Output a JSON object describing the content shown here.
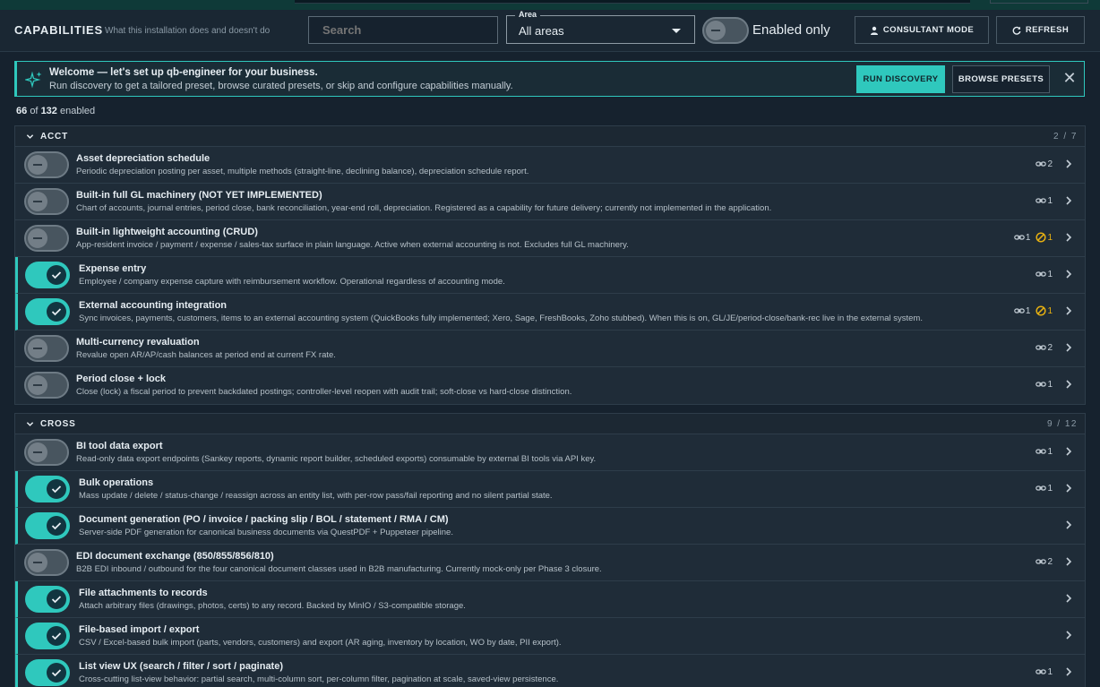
{
  "header": {
    "title": "CAPABILITIES",
    "subtitle": "What this installation does and doesn't do",
    "search_placeholder": "Search",
    "area_label": "Area",
    "area_value": "All areas",
    "enabled_only_label": "Enabled only",
    "consultant_label": "CONSULTANT MODE",
    "refresh_label": "REFRESH"
  },
  "banner": {
    "title": "Welcome — let's set up qb-engineer for your business.",
    "text": "Run discovery to get a tailored preset, browse curated presets, or skip and configure capabilities manually.",
    "run_label": "RUN DISCOVERY",
    "presets_label": "BROWSE PRESETS",
    "close_glyph": "✕"
  },
  "counter": {
    "enabled": "66",
    "of": "of",
    "total": "132",
    "suffix": "enabled"
  },
  "colors": {
    "accent": "#2fc8bd",
    "warning": "#e6b012",
    "background": "#16222e"
  },
  "sections": [
    {
      "name": "ACCT",
      "count": "2 / 7",
      "rows": [
        {
          "title": "Asset depreciation schedule",
          "desc": "Periodic depreciation posting per asset, multiple methods (straight-line, declining balance), depreciation schedule report.",
          "enabled": false,
          "links": "2",
          "warn": ""
        },
        {
          "title": "Built-in full GL machinery (NOT YET IMPLEMENTED)",
          "desc": "Chart of accounts, journal entries, period close, bank reconciliation, year-end roll, depreciation. Registered as a capability for future delivery; currently not implemented in the application.",
          "enabled": false,
          "links": "1",
          "warn": ""
        },
        {
          "title": "Built-in lightweight accounting (CRUD)",
          "desc": "App-resident invoice / payment / expense / sales-tax surface in plain language. Active when external accounting is not. Excludes full GL machinery.",
          "enabled": false,
          "links": "1",
          "warn": "1"
        },
        {
          "title": "Expense entry",
          "desc": "Employee / company expense capture with reimbursement workflow. Operational regardless of accounting mode.",
          "enabled": true,
          "links": "1",
          "warn": ""
        },
        {
          "title": "External accounting integration",
          "desc": "Sync invoices, payments, customers, items to an external accounting system (QuickBooks fully implemented; Xero, Sage, FreshBooks, Zoho stubbed). When this is on, GL/JE/period-close/bank-rec live in the external system.",
          "enabled": true,
          "links": "1",
          "warn": "1"
        },
        {
          "title": "Multi-currency revaluation",
          "desc": "Revalue open AR/AP/cash balances at period end at current FX rate.",
          "enabled": false,
          "links": "2",
          "warn": ""
        },
        {
          "title": "Period close + lock",
          "desc": "Close (lock) a fiscal period to prevent backdated postings; controller-level reopen with audit trail; soft-close vs hard-close distinction.",
          "enabled": false,
          "links": "1",
          "warn": ""
        }
      ]
    },
    {
      "name": "CROSS",
      "count": "9 / 12",
      "rows": [
        {
          "title": "BI tool data export",
          "desc": "Read-only data export endpoints (Sankey reports, dynamic report builder, scheduled exports) consumable by external BI tools via API key.",
          "enabled": false,
          "links": "1",
          "warn": ""
        },
        {
          "title": "Bulk operations",
          "desc": "Mass update / delete / status-change / reassign across an entity list, with per-row pass/fail reporting and no silent partial state.",
          "enabled": true,
          "links": "1",
          "warn": ""
        },
        {
          "title": "Document generation (PO / invoice / packing slip / BOL / statement / RMA / CM)",
          "desc": "Server-side PDF generation for canonical business documents via QuestPDF + Puppeteer pipeline.",
          "enabled": true,
          "links": "",
          "warn": ""
        },
        {
          "title": "EDI document exchange (850/855/856/810)",
          "desc": "B2B EDI inbound / outbound for the four canonical document classes used in B2B manufacturing. Currently mock-only per Phase 3 closure.",
          "enabled": false,
          "links": "2",
          "warn": ""
        },
        {
          "title": "File attachments to records",
          "desc": "Attach arbitrary files (drawings, photos, certs) to any record. Backed by MinIO / S3-compatible storage.",
          "enabled": true,
          "links": "",
          "warn": ""
        },
        {
          "title": "File-based import / export",
          "desc": "CSV / Excel-based bulk import (parts, vendors, customers) and export (AR aging, inventory by location, WO by date, PII export).",
          "enabled": true,
          "links": "",
          "warn": ""
        },
        {
          "title": "List view UX (search / filter / sort / paginate)",
          "desc": "Cross-cutting list-view behavior: partial search, multi-column sort, per-column filter, pagination at scale, saved-view persistence.",
          "enabled": true,
          "links": "1",
          "warn": ""
        }
      ]
    }
  ]
}
